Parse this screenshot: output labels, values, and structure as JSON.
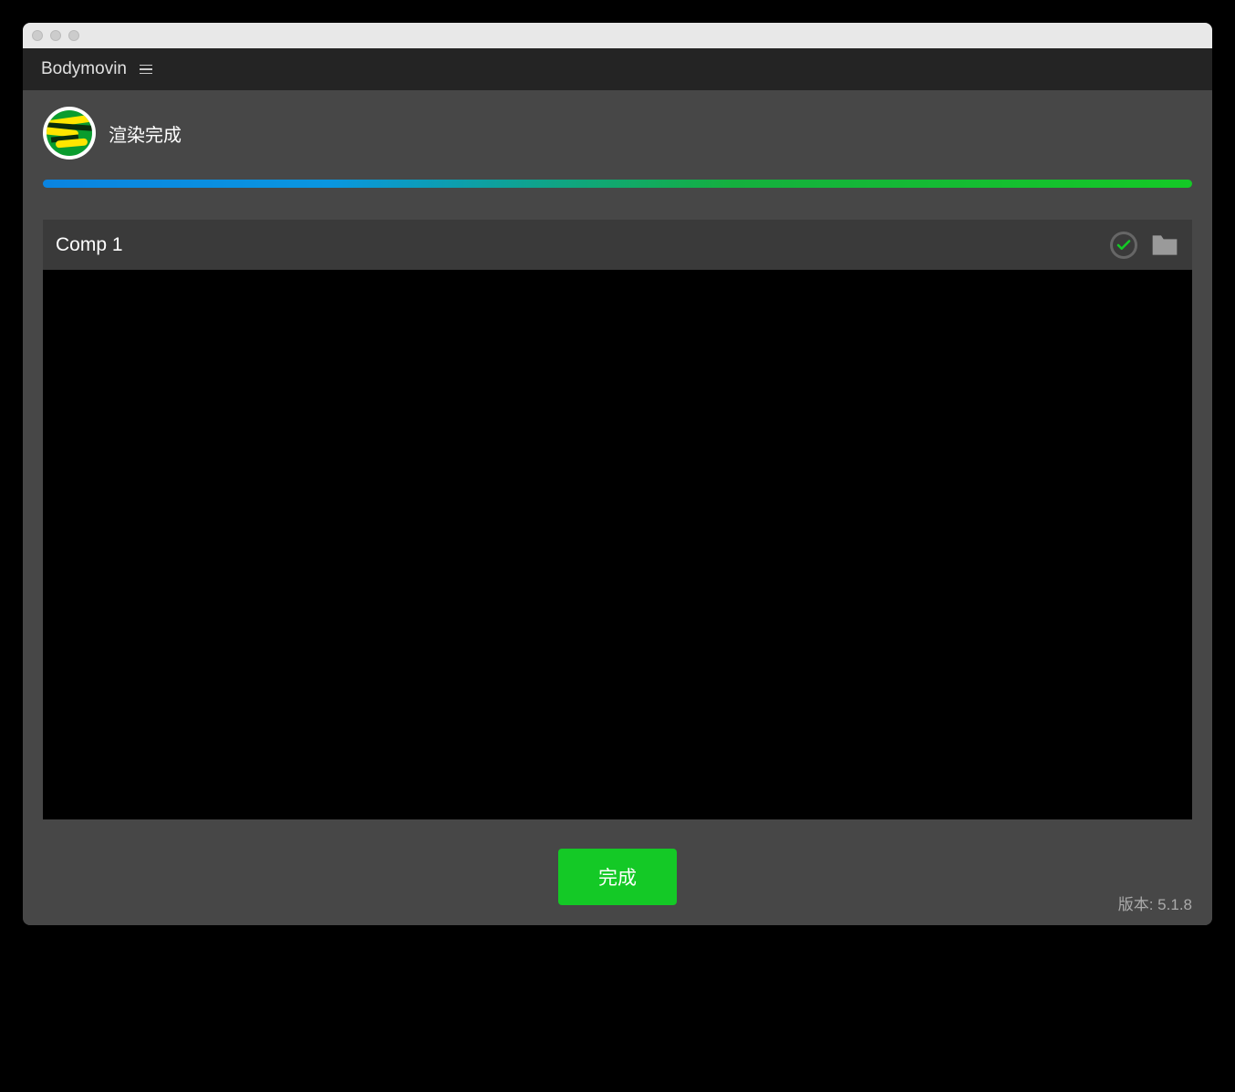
{
  "app": {
    "title": "Bodymovin"
  },
  "status": {
    "text": "渲染完成",
    "progress_percent": 100
  },
  "composition": {
    "name": "Comp 1"
  },
  "actions": {
    "done_label": "完成"
  },
  "version": {
    "label": "版本: 5.1.8"
  },
  "icons": {
    "check": "check-circle-icon",
    "folder": "folder-icon",
    "menu": "hamburger-icon"
  },
  "colors": {
    "accent_green": "#14c926",
    "progress_start": "#0a84e0",
    "progress_end": "#14c926",
    "header_bg": "#242424",
    "panel_bg": "#474747"
  }
}
